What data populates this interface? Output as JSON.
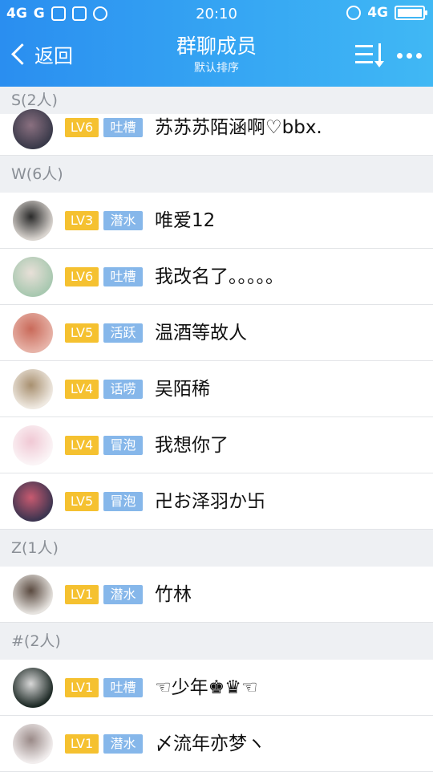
{
  "status_bar": {
    "signal1": "4G",
    "signal2": "G",
    "time": "20:10",
    "network": "4G",
    "battery_level": 1.0
  },
  "nav": {
    "back_label": "返回",
    "title": "群聊成员",
    "subtitle": "默认排序"
  },
  "sections": [
    {
      "header": "S(2人)",
      "members": [
        {
          "level": "LV6",
          "tag": "吐槽",
          "name": "苏苏苏陌涵啊♡bbx.",
          "avatar_color": "#3a3a4a",
          "avatar_color2": "#8a7080"
        }
      ]
    },
    {
      "header": "W(6人)",
      "members": [
        {
          "level": "LV3",
          "tag": "潜水",
          "name": "唯爱12",
          "avatar_color": "#d9d4cf",
          "avatar_color2": "#2a2a2a"
        },
        {
          "level": "LV6",
          "tag": "吐槽",
          "name": "我改名了。。。。。",
          "avatar_color": "#a8c8b0",
          "avatar_color2": "#e8e0d8"
        },
        {
          "level": "LV5",
          "tag": "活跃",
          "name": "温酒等故人",
          "avatar_color": "#e7b3a8",
          "avatar_color2": "#c96a5a"
        },
        {
          "level": "LV4",
          "tag": "话唠",
          "name": "吴陌稀",
          "avatar_color": "#efe9e1",
          "avatar_color2": "#a89070"
        },
        {
          "level": "LV4",
          "tag": "冒泡",
          "name": "我想你了",
          "avatar_color": "#fbf4f6",
          "avatar_color2": "#f0c8d4"
        },
        {
          "level": "LV5",
          "tag": "冒泡",
          "name": "卍お泽羽か卐",
          "avatar_color": "#3d3550",
          "avatar_color2": "#c85a70"
        }
      ]
    },
    {
      "header": "Z(1人)",
      "members": [
        {
          "level": "LV1",
          "tag": "潜水",
          "name": "竹林",
          "avatar_color": "#e6e3df",
          "avatar_color2": "#5a4a40"
        }
      ]
    },
    {
      "header": "#(2人)",
      "members": [
        {
          "level": "LV1",
          "tag": "吐槽",
          "name": "☜少年♚♛☜",
          "avatar_color": "#1e2a26",
          "avatar_color2": "#d8d8d8"
        },
        {
          "level": "LV1",
          "tag": "潜水",
          "name": "〆流年亦梦ヽ",
          "avatar_color": "#f2eeee",
          "avatar_color2": "#9a8a88"
        }
      ]
    }
  ]
}
